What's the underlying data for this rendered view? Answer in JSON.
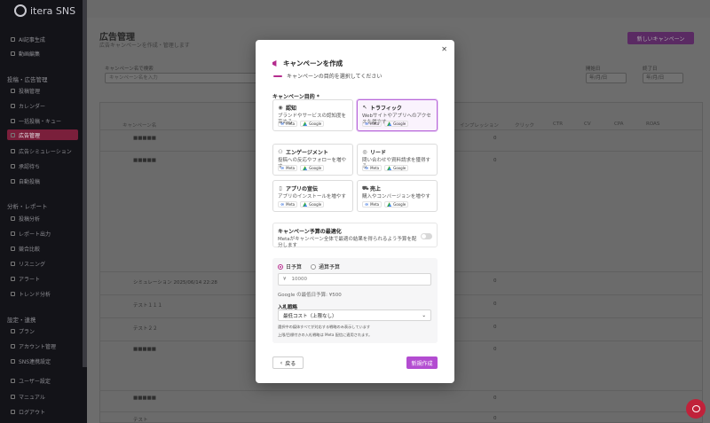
{
  "app": {
    "brand": "itera SNS"
  },
  "sidebar": {
    "top_items": [
      {
        "label": "AI記事生成"
      },
      {
        "label": "動画編集"
      }
    ],
    "section1": "投稿・広告管理",
    "items1": [
      {
        "label": "投稿管理"
      },
      {
        "label": "カレンダー"
      },
      {
        "label": "一括投稿・キュー"
      },
      {
        "label": "広告管理"
      },
      {
        "label": "広告シミュレーション"
      },
      {
        "label": "承認待ち"
      },
      {
        "label": "自動投稿"
      }
    ],
    "section2": "分析・レポート",
    "items2": [
      {
        "label": "投稿分析"
      },
      {
        "label": "レポート出力"
      },
      {
        "label": "競合比較"
      },
      {
        "label": "リスニング"
      },
      {
        "label": "アラート"
      },
      {
        "label": "トレンド分析"
      }
    ],
    "section3": "設定・連携",
    "items3": [
      {
        "label": "プラン"
      },
      {
        "label": "アカウント管理"
      },
      {
        "label": "SNS連携設定"
      }
    ],
    "bottom": [
      {
        "label": "ユーザー設定"
      },
      {
        "label": "マニュアル"
      },
      {
        "label": "ログアウト"
      }
    ]
  },
  "page": {
    "title": "広告管理",
    "subtitle": "広告キャンペーンを作成・管理します",
    "filter_label": "キャンペーン名で検索",
    "filter_placeholder": "キャンペーン名を入力",
    "start_label": "開始日",
    "end_label": "終了日",
    "date_placeholder": "年/月/日",
    "table_headers": [
      "キャンペーン名",
      "ステータス",
      "媒体",
      "インプレッション",
      "クリック",
      "CTR",
      "CV",
      "CPA",
      "ROAS",
      "消化金額"
    ],
    "rows": [
      {
        "name": "■■■■■",
        "amount": "0"
      },
      {
        "name": "■■■■■",
        "amount": "0"
      },
      {
        "name": "シミュレーション 2025/06/14 22:28",
        "amount": "0"
      },
      {
        "name": "テスト１１１",
        "amount": "0"
      },
      {
        "name": "テスト２２",
        "amount": "0"
      },
      {
        "name": "■■■■■",
        "amount": "0"
      },
      {
        "name": "■■■■■",
        "amount": "0"
      },
      {
        "name": "テスト",
        "amount": "0"
      }
    ],
    "create_btn": "新しいキャンペーン"
  },
  "modal": {
    "title": "キャンペーンを作成",
    "step_text": "キャンペーンの目的を選択してください",
    "objective_label": "キャンペーン目的 *",
    "objectives": [
      {
        "icon": "eye-icon",
        "glyph": "◉",
        "title": "認知",
        "desc": "ブランドやサービスの認知度を高める",
        "selected": false
      },
      {
        "icon": "cursor-icon",
        "glyph": "↖",
        "title": "トラフィック",
        "desc": "Webサイトやアプリへのアクセスを増やす",
        "selected": true
      },
      {
        "icon": "users-icon",
        "glyph": "⚇",
        "title": "エンゲージメント",
        "desc": "投稿への反応やフォローを増やす",
        "selected": false
      },
      {
        "icon": "target-icon",
        "glyph": "◎",
        "title": "リード",
        "desc": "問い合わせや資料請求を獲得する",
        "selected": false
      },
      {
        "icon": "phone-icon",
        "glyph": "▯",
        "title": "アプリの宣伝",
        "desc": "アプリのインストールを増やす",
        "selected": false
      },
      {
        "icon": "cart-icon",
        "glyph": "⛟",
        "title": "売上",
        "desc": "購入やコンバージョンを増やす",
        "selected": false
      }
    ],
    "platform_tags": [
      "Meta",
      "Google"
    ],
    "optimize_title": "キャンペーン予算の最適化",
    "optimize_desc": "Metaがキャンペーン全体で最適の結果を得られるよう予算を配分します",
    "budget_daily": "日予算",
    "budget_total": "通算予算",
    "amount_currency": "¥",
    "amount_value": "10000",
    "min_note": "Google の最低日予算: ¥500",
    "bid_label": "入札戦略",
    "bid_value": "最低コスト（上限なし）",
    "note1": "選択中の媒体すべてが対応する戦略のみ表示しています",
    "note2": "上限/目標付きの入札戦略は Meta 配信に適用されます。",
    "back_btn": "戻る",
    "create_btn": "新規作成"
  },
  "colors": {
    "accent": "#b34cd1",
    "brand": "#b52d8e",
    "meta": "#1a5bd8"
  }
}
